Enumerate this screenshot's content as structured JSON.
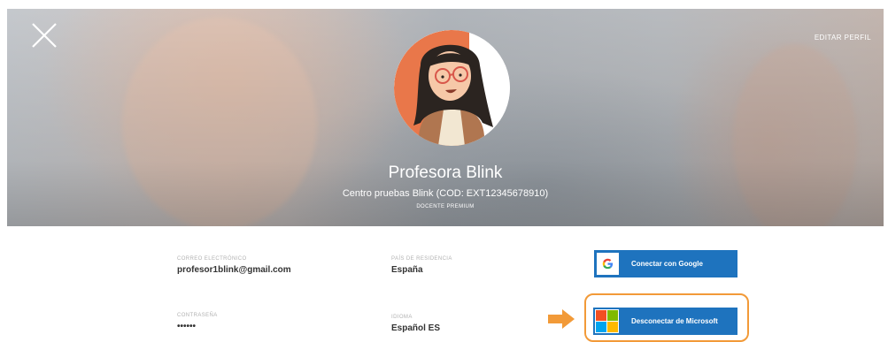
{
  "header": {
    "edit_profile": "EDITAR PERFIL",
    "name": "Profesora Blink",
    "school": "Centro pruebas Blink (COD: EXT12345678910)",
    "badge": "DOCENTE PREMIUM"
  },
  "fields": {
    "email": {
      "label": "CORREO ELECTRÓNICO",
      "value": "profesor1blink@gmail.com"
    },
    "country": {
      "label": "PAÍS DE RESIDENCIA",
      "value": "España"
    },
    "password": {
      "label": "CONTRASEÑA",
      "value": "••••••"
    },
    "language": {
      "label": "IDIOMA",
      "value": "Español ES"
    }
  },
  "buttons": {
    "google": "Conectar con Google",
    "microsoft": "Desconectar de Microsoft"
  },
  "icons": {
    "close": "close-icon",
    "google": "google-logo-icon",
    "microsoft": "microsoft-logo-icon",
    "arrow": "arrow-right-icon"
  },
  "colors": {
    "button": "#1e73be",
    "highlight": "#f29a38",
    "avatar_ring": "#e9774a"
  }
}
